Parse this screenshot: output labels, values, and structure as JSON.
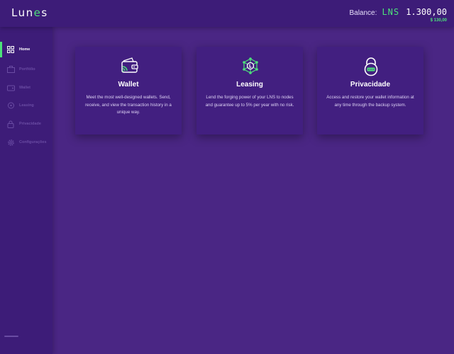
{
  "header": {
    "logo": {
      "pre": "Lun",
      "accent": "e",
      "post": "s"
    },
    "balance": {
      "label": "Balance:",
      "currency": "LNS",
      "amount": "1.300,00",
      "usd": "$ 130,00"
    }
  },
  "sidebar": {
    "items": [
      {
        "label": "Home",
        "icon": "home-icon",
        "active": true
      },
      {
        "label": "Portfólio",
        "icon": "portfolio-icon",
        "active": false
      },
      {
        "label": "Wallet",
        "icon": "wallet-icon",
        "active": false
      },
      {
        "label": "Leasing",
        "icon": "leasing-icon",
        "active": false
      },
      {
        "label": "Privacidade",
        "icon": "lock-icon",
        "active": false
      },
      {
        "label": "Configurações",
        "icon": "gear-icon",
        "active": false
      }
    ]
  },
  "cards": [
    {
      "title": "Wallet",
      "description": "Meet the most well-designed wallets. Send, receive, and view the transaction history in a unique way.",
      "icon": "wallet-icon"
    },
    {
      "title": "Leasing",
      "description": "Lend the forging power of your LNS to nodes and guarantee up to 5% per year with no risk.",
      "icon": "leasing-network-icon"
    },
    {
      "title": "Privacidade",
      "description": "Access and restore your wallet information at any time through the backup system.",
      "icon": "padlock-icon"
    }
  ],
  "colors": {
    "accent": "#4ce37a",
    "background": "#4a2684",
    "panel": "#3d1c78",
    "card": "#421f80"
  }
}
